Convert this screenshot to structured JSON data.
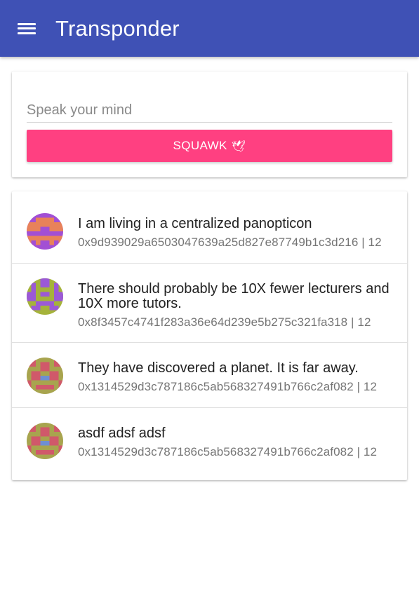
{
  "app": {
    "title": "Transponder"
  },
  "composer": {
    "placeholder": "Speak your mind",
    "value": "",
    "button_label": "SQUAWK",
    "button_emoji": "🕊"
  },
  "colors": {
    "appbar": "#3f51b5",
    "accent": "#ff4081"
  },
  "posts": [
    {
      "text": "I am living in a centralized panopticon",
      "meta": "0x9d939029a6503047639a25d827e87749b1c3d216 | 12",
      "avatar": "identicon-purple-orange"
    },
    {
      "text": "There should probably be 10X fewer lecturers and 10X more tutors.",
      "meta": "0x8f3457c4741f283a36e64d239e5b275c321fa318 | 12",
      "avatar": "identicon-purple-olive"
    },
    {
      "text": "They have discovered a planet. It is far away.",
      "meta": "0x1314529d3c787186c5ab568327491b766c2af082 | 12",
      "avatar": "identicon-red-olive"
    },
    {
      "text": "asdf adsf adsf",
      "meta": "0x1314529d3c787186c5ab568327491b766c2af082 | 12",
      "avatar": "identicon-red-olive"
    }
  ]
}
